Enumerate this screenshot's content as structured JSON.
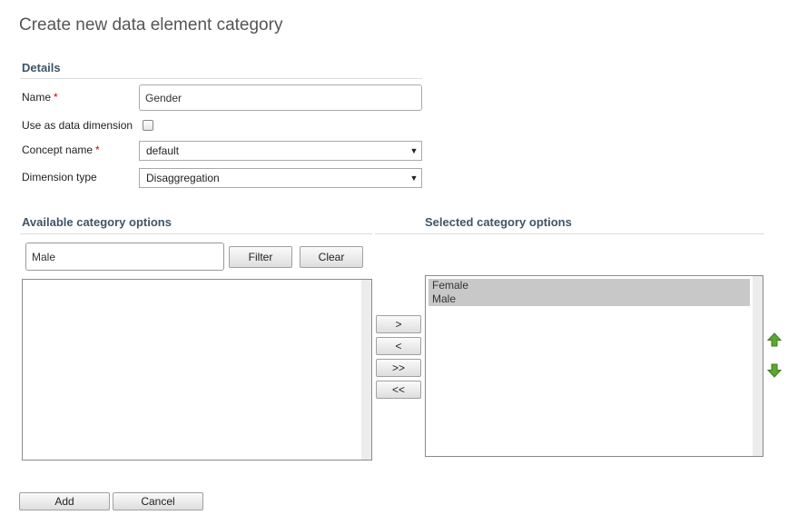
{
  "page": {
    "title": "Create new data element category"
  },
  "details": {
    "heading": "Details",
    "name_label": "Name",
    "name_value": "Gender",
    "data_dimension_label": "Use as data dimension",
    "concept_label": "Concept name",
    "concept_value": "default",
    "dimension_type_label": "Dimension type",
    "dimension_type_value": "Disaggregation",
    "required_mark": "*"
  },
  "available": {
    "heading": "Available category options",
    "filter_value": "Male",
    "filter_label": "Filter",
    "clear_label": "Clear",
    "items": []
  },
  "selected": {
    "heading": "Selected category options",
    "items": [
      "Female",
      "Male"
    ]
  },
  "transfer": {
    "move_right": ">",
    "move_left": "<",
    "move_all_right": ">>",
    "move_all_left": "<<"
  },
  "footer": {
    "add_label": "Add",
    "cancel_label": "Cancel"
  },
  "colors": {
    "accent_green": "#5aa832",
    "heading_blue": "#3f5568",
    "required_red": "#cc0000"
  }
}
